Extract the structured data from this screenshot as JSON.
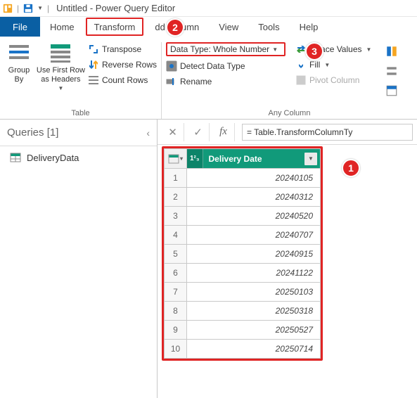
{
  "window": {
    "title": "Untitled - Power Query Editor"
  },
  "tabs": {
    "file": "File",
    "home": "Home",
    "transform": "Transform",
    "add_column": "dd Column",
    "view": "View",
    "tools": "Tools",
    "help": "Help"
  },
  "ribbon": {
    "group_by": "Group\nBy",
    "first_row": "Use First Row\nas Headers",
    "transpose": "Transpose",
    "reverse_rows": "Reverse Rows",
    "count_rows": "Count Rows",
    "table_group": "Table",
    "datatype_label": "Data Type: Whole Number",
    "detect": "Detect Data Type",
    "rename": "Rename",
    "replace": "eplace Values",
    "fill": "Fill",
    "pivot": "Pivot Column",
    "anycol_group": "Any Column"
  },
  "queries_pane": {
    "header": "Queries [1]",
    "item": "DeliveryData"
  },
  "formula": {
    "text": "= Table.TransformColumnTy"
  },
  "grid": {
    "column_type_chip": "1²₃",
    "column_name": "Delivery Date",
    "rows": [
      {
        "n": "1",
        "v": "20240105"
      },
      {
        "n": "2",
        "v": "20240312"
      },
      {
        "n": "3",
        "v": "20240520"
      },
      {
        "n": "4",
        "v": "20240707"
      },
      {
        "n": "5",
        "v": "20240915"
      },
      {
        "n": "6",
        "v": "20241122"
      },
      {
        "n": "7",
        "v": "20250103"
      },
      {
        "n": "8",
        "v": "20250318"
      },
      {
        "n": "9",
        "v": "20250527"
      },
      {
        "n": "10",
        "v": "20250714"
      }
    ]
  },
  "callouts": {
    "c1": "1",
    "c2": "2",
    "c3": "3"
  }
}
